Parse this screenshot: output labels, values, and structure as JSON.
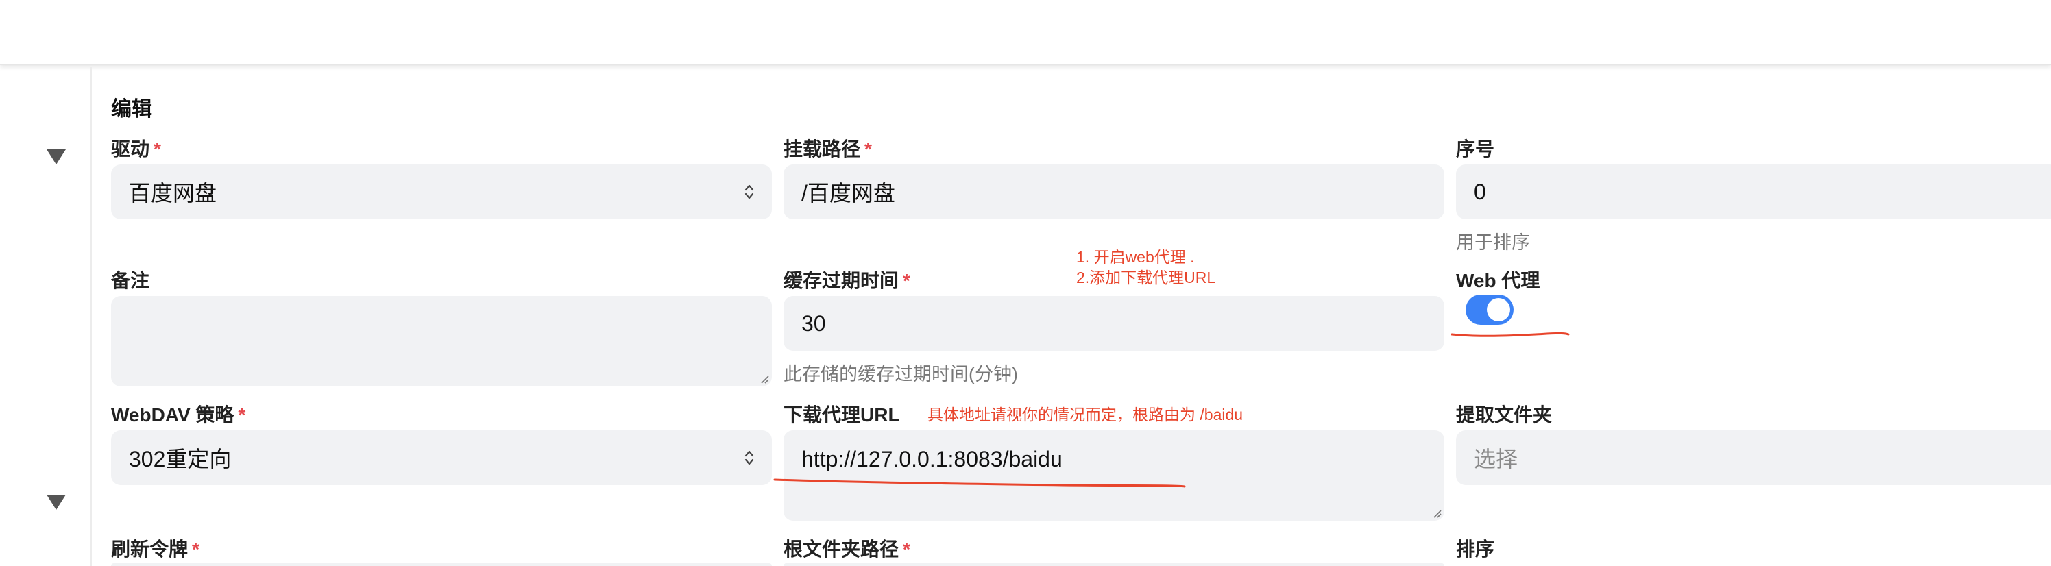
{
  "form": {
    "title": "编辑",
    "required_mark": "*",
    "driver": {
      "label": "驱动",
      "value": "百度网盘"
    },
    "mount_path": {
      "label": "挂载路径",
      "value": "/百度网盘"
    },
    "order": {
      "label": "序号",
      "value": "0",
      "help": "用于排序"
    },
    "remark": {
      "label": "备注",
      "value": ""
    },
    "cache_expiration": {
      "label": "缓存过期时间",
      "value": "30",
      "help": "此存储的缓存过期时间(分钟)"
    },
    "web_proxy": {
      "label": "Web 代理",
      "enabled": true
    },
    "webdav_policy": {
      "label": "WebDAV 策略",
      "value": "302重定向"
    },
    "download_proxy_url": {
      "label": "下载代理URL",
      "value": "http://127.0.0.1:8083/baidu"
    },
    "extract_folder": {
      "label": "提取文件夹",
      "placeholder": "选择"
    },
    "refresh_token": {
      "label": "刷新令牌"
    },
    "root_folder_path": {
      "label": "根文件夹路径"
    },
    "sort": {
      "label": "排序"
    }
  },
  "annotations": {
    "step1": "1. 开启web代理      .",
    "step2": "2.添加下载代理URL",
    "url_note": "具体地址请视你的情况而定，根路由为 /baidu",
    "color": "#e8452c"
  },
  "colors": {
    "accent": "#3b82f6",
    "required": "#e5484d",
    "field_bg": "#f1f2f4"
  }
}
